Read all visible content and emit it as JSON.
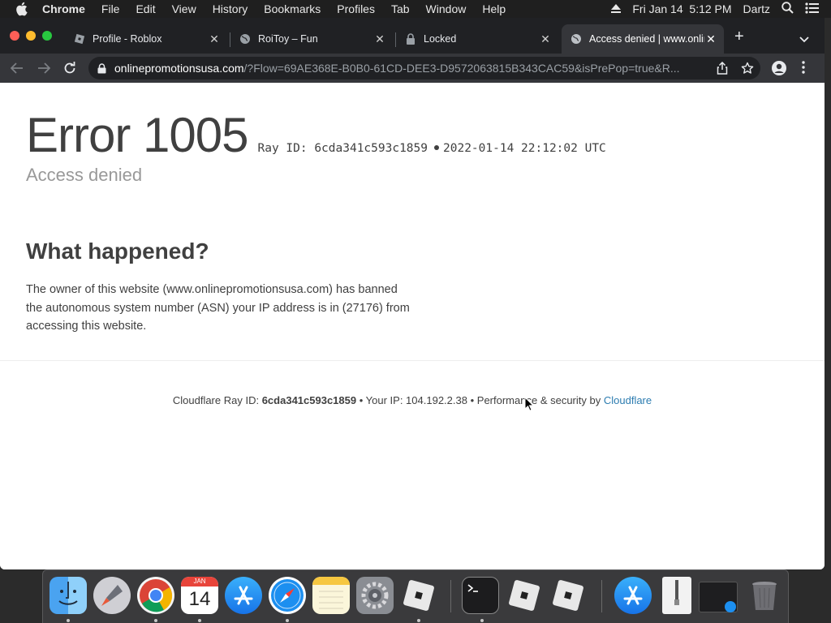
{
  "menubar": {
    "app_name": "Chrome",
    "items": [
      "File",
      "Edit",
      "View",
      "History",
      "Bookmarks",
      "Profiles",
      "Tab",
      "Window",
      "Help"
    ],
    "clock": "Fri Jan 14  5:12 PM",
    "user": "Dartz"
  },
  "tabs": [
    {
      "title": "Profile - Roblox",
      "icon": "roblox-icon",
      "active": false
    },
    {
      "title": "RoiToy – Fun",
      "icon": "globe-icon",
      "active": false
    },
    {
      "title": "Locked",
      "icon": "lock-icon",
      "active": false
    },
    {
      "title": "Access denied | www.onlinepromotionsusa.com",
      "icon": "globe-icon",
      "active": true
    }
  ],
  "toolbar": {
    "url_host": "onlinepromotionsusa.com",
    "url_path": "/?Flow=69AE368E-B0B0-61CD-DEE3-D9572063815B343CAC59&isPrePop=true&R..."
  },
  "page": {
    "error_title": "Error 1005",
    "ray_label": "Ray ID: 6cda341c593c1859",
    "timestamp": "2022-01-14 22:12:02 UTC",
    "subtitle": "Access denied",
    "what_heading": "What happened?",
    "explanation": "The owner of this website (www.onlinepromotionsusa.com) has banned the autonomous system number (ASN) your IP address is in (27176) from accessing this website.",
    "footer": {
      "ray_prefix": "Cloudflare Ray ID:",
      "ray_id": "6cda341c593c1859",
      "sep1": "•",
      "ip_text": "Your IP: 104.192.2.38",
      "sep2": "•",
      "perf_text": "Performance & security by",
      "link": "Cloudflare"
    }
  },
  "dock": {
    "apps": [
      "Finder",
      "Launchpad",
      "Google Chrome",
      "Calendar",
      "App Store",
      "Safari",
      "Notes",
      "System Preferences",
      "Roblox",
      "Terminal",
      "Roblox Player",
      "Roblox Studio",
      "App Store Downloads",
      "Archive",
      "Screen Recording",
      "Trash"
    ],
    "calendar_month": "JAN",
    "calendar_day": "14"
  },
  "colors": {
    "tab_strip": "#202124",
    "toolbar": "#35363a",
    "link": "#2c7cb0",
    "heading_text": "#404040",
    "muted_text": "#999999"
  }
}
